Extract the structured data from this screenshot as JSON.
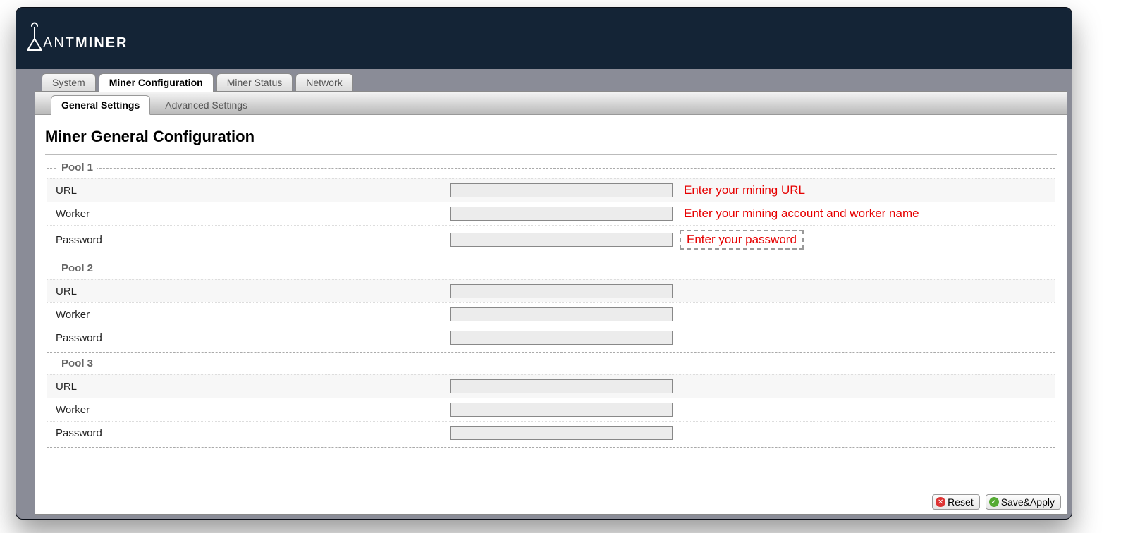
{
  "brand": {
    "prefix": "ANT",
    "suffix": "MINER"
  },
  "mainTabs": [
    "System",
    "Miner Configuration",
    "Miner Status",
    "Network"
  ],
  "activeMainTab": 1,
  "subTabs": [
    "General Settings",
    "Advanced Settings"
  ],
  "activeSubTab": 0,
  "pageTitle": "Miner General Configuration",
  "fieldLabels": {
    "url": "URL",
    "worker": "Worker",
    "password": "Password"
  },
  "pools": [
    {
      "legend": "Pool 1",
      "url": "",
      "worker": "",
      "password": "",
      "hints": {
        "url": "Enter your mining URL",
        "worker": "Enter your mining account and worker name",
        "password": "Enter your password",
        "passwordBoxed": true
      }
    },
    {
      "legend": "Pool 2",
      "url": "",
      "worker": "",
      "password": "",
      "hints": {}
    },
    {
      "legend": "Pool 3",
      "url": "",
      "worker": "",
      "password": "",
      "hints": {}
    }
  ],
  "buttons": {
    "reset": "Reset",
    "save": "Save&Apply"
  }
}
